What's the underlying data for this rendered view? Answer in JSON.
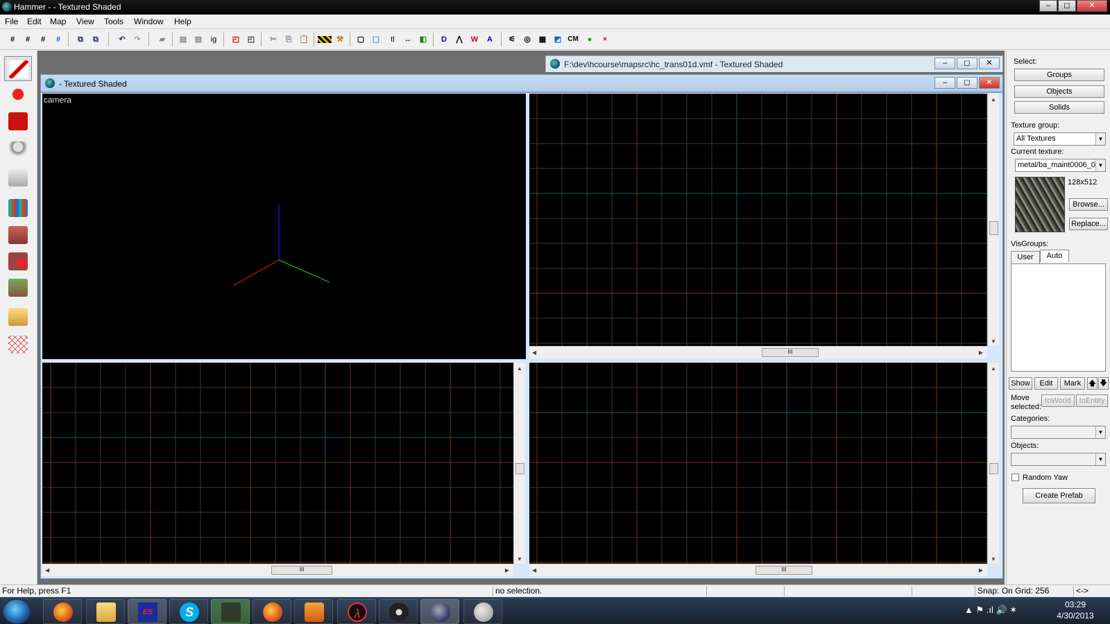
{
  "window": {
    "title": "Hammer -  - Textured Shaded",
    "min": "–",
    "max": "◻",
    "close": "✕"
  },
  "menu": [
    "File",
    "Edit",
    "Map",
    "View",
    "Tools",
    "Window",
    "Help"
  ],
  "toolbar": {
    "ig": "ig",
    "tl": "tl",
    "cm": "CM"
  },
  "mdi": {
    "file_window_title": "F:\\dev\\hcourse\\mapsrc\\hc_trans01d.vmf - Textured Shaded",
    "child_window_title": "- Textured Shaded",
    "camera_label": "camera",
    "scroll_grip": "III"
  },
  "panel": {
    "select_label": "Select:",
    "groups": "Groups",
    "objects_btn": "Objects",
    "solids": "Solids",
    "texture_group_label": "Texture group:",
    "texture_group_value": "All Textures",
    "current_texture_label": "Current texture:",
    "current_texture_value": "metal/ba_maint0006_0:",
    "texture_size": "128x512",
    "browse": "Browse...",
    "replace": "Replace...",
    "visgroups_label": "VisGroups:",
    "tab_user": "User",
    "tab_auto": "Auto",
    "show": "Show",
    "edit": "Edit",
    "mark": "Mark",
    "up": "🡅",
    "down": "🡇",
    "move_selected": "Move selected:",
    "to_world": "toWorld",
    "to_entity": "toEntity",
    "categories_label": "Categories:",
    "objects_label": "Objects:",
    "random_yaw": "Random Yaw",
    "create_prefab": "Create Prefab",
    "dropdown_arrow": "▼"
  },
  "status": {
    "help": "For Help, press F1",
    "selection": "no selection.",
    "snap": "Snap: On Grid: 256",
    "arrows": "<->"
  },
  "taskbar": {
    "time": "03:29",
    "date": "4/30/2013"
  },
  "icons": {
    "es": "ES",
    "s": "S",
    "lambda": "λ",
    "tray": "▲  ⚑  .ıl  🔊  ✶"
  },
  "colors": {
    "accent": "#2d6fb5",
    "grid_line": "#3a3a3a",
    "grid_major": "#6b3a1d",
    "grid_axis": "#1d5d5d"
  }
}
